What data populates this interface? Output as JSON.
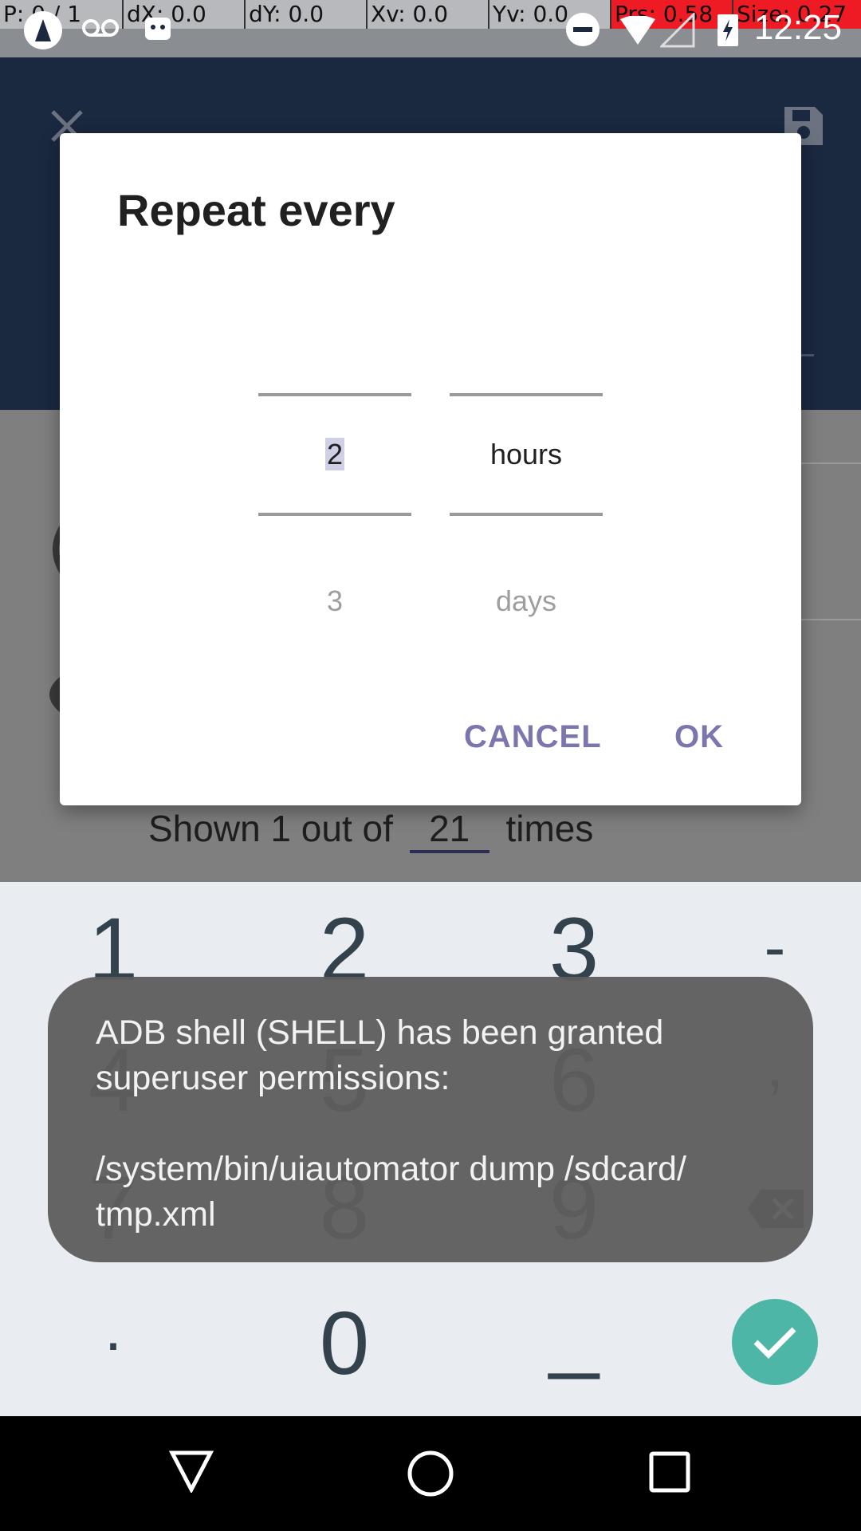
{
  "debug_bar": {
    "pointer": "P: 0 / 1",
    "dx": "dX: 0.0",
    "dy": "dY: 0.0",
    "xv": "Xv: 0.0",
    "yv": "Yv: 0.0",
    "prs": "Prs: 0.58",
    "size": "Size: 0.27"
  },
  "status_bar": {
    "time": "12:25",
    "icons": [
      "app-logo-icon",
      "voicemail-icon",
      "android-debug-icon",
      "do-not-disturb-icon",
      "wifi-icon",
      "signal-icon",
      "battery-charging-icon"
    ]
  },
  "dialog": {
    "title": "Repeat every",
    "number_picker": {
      "selected": "2",
      "next": "3"
    },
    "unit_picker": {
      "selected": "hours",
      "next": "days"
    },
    "cancel_label": "CANCEL",
    "ok_label": "OK"
  },
  "background": {
    "shown_prefix": "Shown 1 out of",
    "shown_count": "21",
    "shown_suffix": "times"
  },
  "keypad": {
    "keys": [
      "1",
      "2",
      "3",
      "-",
      "4",
      "5",
      "6",
      ",",
      "7",
      "8",
      "9",
      ".",
      "0",
      "_"
    ],
    "accent": "#4db6a6"
  },
  "toast": {
    "message": "ADB shell (SHELL) has been granted\nsuperuser permissions:\n\n/system/bin/uiautomator dump /sdcard/\ntmp.xml"
  },
  "colors": {
    "dialog_button": "#7b76ad",
    "app_bar": "#1a2840"
  }
}
